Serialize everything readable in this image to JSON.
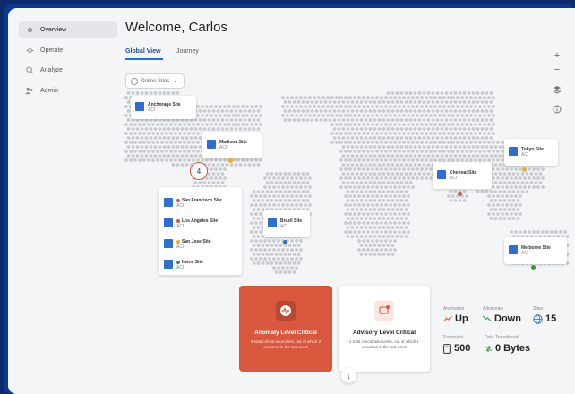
{
  "sidebar": {
    "items": [
      {
        "label": "Overview",
        "icon": "gear-icon"
      },
      {
        "label": "Operate",
        "icon": "gear-icon"
      },
      {
        "label": "Analyze",
        "icon": "search-icon"
      },
      {
        "label": "Admin",
        "icon": "users-icon"
      }
    ]
  },
  "header": {
    "title": "Welcome, Carlos"
  },
  "tabs": [
    {
      "label": "Global View"
    },
    {
      "label": "Journey"
    }
  ],
  "filter": {
    "label": "Online Sites"
  },
  "cluster": {
    "count": "4"
  },
  "sites": {
    "anchorage": {
      "name": "Anchorage Site",
      "type": "ACI"
    },
    "madison": {
      "name": "Madison Site",
      "type": "ACI"
    },
    "tokyo": {
      "name": "Tokyo Site",
      "type": "ACI"
    },
    "chennai": {
      "name": "Chennai Site",
      "type": "ACI"
    },
    "brazil": {
      "name": "Brazil Site",
      "type": "ACI"
    },
    "melborne": {
      "name": "Melborne Site",
      "type": "ACI"
    }
  },
  "cluster_list": [
    {
      "name": "San Francisco Site",
      "type": "ACI",
      "status": "#e0533a"
    },
    {
      "name": "Los Angeles Site",
      "type": "ACI",
      "status": "#e0533a"
    },
    {
      "name": "San Jose Site",
      "type": "ACI",
      "status": "#e6b020"
    },
    {
      "name": "Irvine Site",
      "type": "ACI",
      "status": "#3a9a3a"
    }
  ],
  "anomaly": {
    "title": "Anomaly Level Critical",
    "desc": "5 total critical anomalies, out of which 2 occurred in the last week",
    "color": "#d9573d"
  },
  "advisory": {
    "title": "Advisory Level Critical",
    "desc": "2 total critical advisories, out of which 1 occurred in the last week"
  },
  "stats": {
    "anomalies": {
      "label": "Anomalies",
      "value": "Up"
    },
    "advisories": {
      "label": "Advisories",
      "value": "Down"
    },
    "sites": {
      "label": "Sites",
      "value": "15"
    },
    "endpoints": {
      "label": "Endpoints",
      "value": "500"
    },
    "data": {
      "label": "Data Transferred",
      "value": "0 Bytes"
    }
  }
}
